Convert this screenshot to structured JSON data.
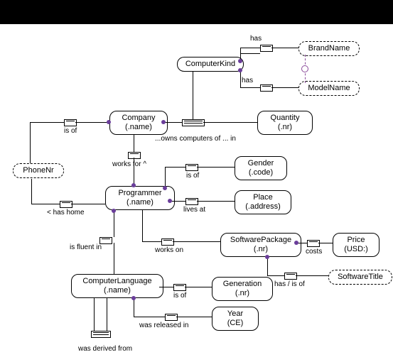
{
  "entities": {
    "computerKind": "ComputerKind",
    "brandName": "BrandName",
    "modelName": "ModelName",
    "company": {
      "l1": "Company",
      "l2": "(.name)"
    },
    "quantity": {
      "l1": "Quantity",
      "l2": "(.nr)"
    },
    "phoneNr": "PhoneNr",
    "programmer": {
      "l1": "Programmer",
      "l2": "(.name)"
    },
    "gender": {
      "l1": "Gender",
      "l2": "(.code)"
    },
    "place": {
      "l1": "Place",
      "l2": "(.address)"
    },
    "softwarePackage": {
      "l1": "SoftwarePackage",
      "l2": "(.nr)"
    },
    "price": {
      "l1": "Price",
      "l2": "(USD:)"
    },
    "softwareTitle": "SoftwareTitle",
    "computerLanguage": {
      "l1": "ComputerLanguage",
      "l2": "(.name)"
    },
    "generation": {
      "l1": "Generation",
      "l2": "(.nr)"
    },
    "year": {
      "l1": "Year",
      "l2": "(CE)"
    }
  },
  "labels": {
    "has1": "has",
    "has2": "has",
    "isOf1": "is of",
    "ownsComputers": "...owns computers of ... in",
    "worksFor": "works for ^",
    "isOf2": "is of",
    "hasHome": "< has home",
    "livesAt": "lives at",
    "isFluentIn": "is fluent in",
    "worksOn": "works on",
    "costs": "costs",
    "hasIsOf": "has / is of",
    "isOf3": "is of",
    "wasReleasedIn": "was released in",
    "wasDerivedFrom": "was derived from"
  }
}
